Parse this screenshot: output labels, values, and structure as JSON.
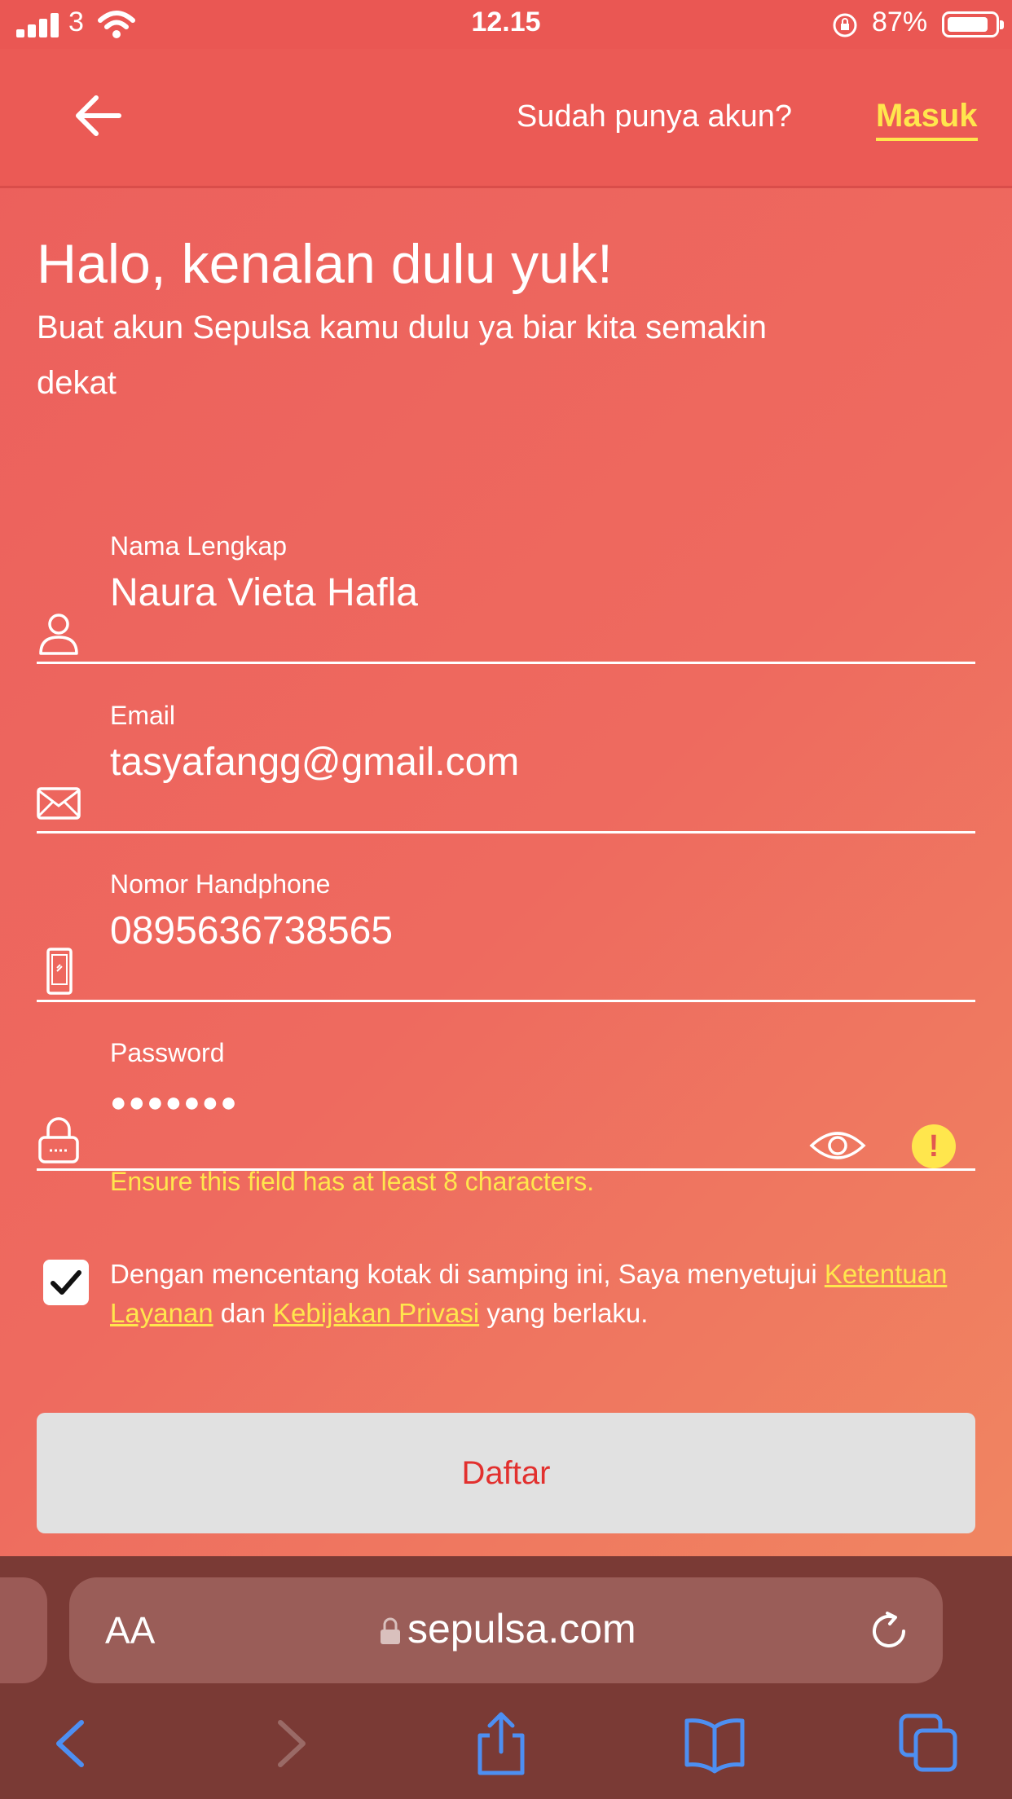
{
  "status": {
    "carrier": "3",
    "time": "12.15",
    "battery": "87%",
    "battery_level": 0.87
  },
  "header": {
    "have_account": "Sudah punya akun?",
    "login": "Masuk"
  },
  "intro": {
    "title": "Halo, kenalan dulu yuk!",
    "subtitle": "Buat akun Sepulsa kamu dulu ya biar kita semakin dekat"
  },
  "form": {
    "name": {
      "label": "Nama Lengkap",
      "value": "Naura Vieta Hafla"
    },
    "email": {
      "label": "Email",
      "value": "tasyafangg@gmail.com"
    },
    "phone": {
      "label": "Nomor Handphone",
      "value": "0895636738565"
    },
    "password": {
      "label": "Password",
      "value": "●●●●●●●",
      "error": "Ensure this field has at least 8 characters."
    }
  },
  "terms": {
    "prefix": "Dengan mencentang kotak di samping ini, Saya menyetujui ",
    "link_terms": "Ketentuan Layanan",
    "middle": " dan ",
    "link_privacy": "Kebijakan Privasi",
    "suffix": " yang berlaku.",
    "checked": true
  },
  "submit_label": "Daftar",
  "browser": {
    "text_size": "AA",
    "domain": "sepulsa.com"
  },
  "colors": {
    "accent": "#ffe64d",
    "background": "#ec5f5c",
    "button_text": "#e2302e"
  }
}
